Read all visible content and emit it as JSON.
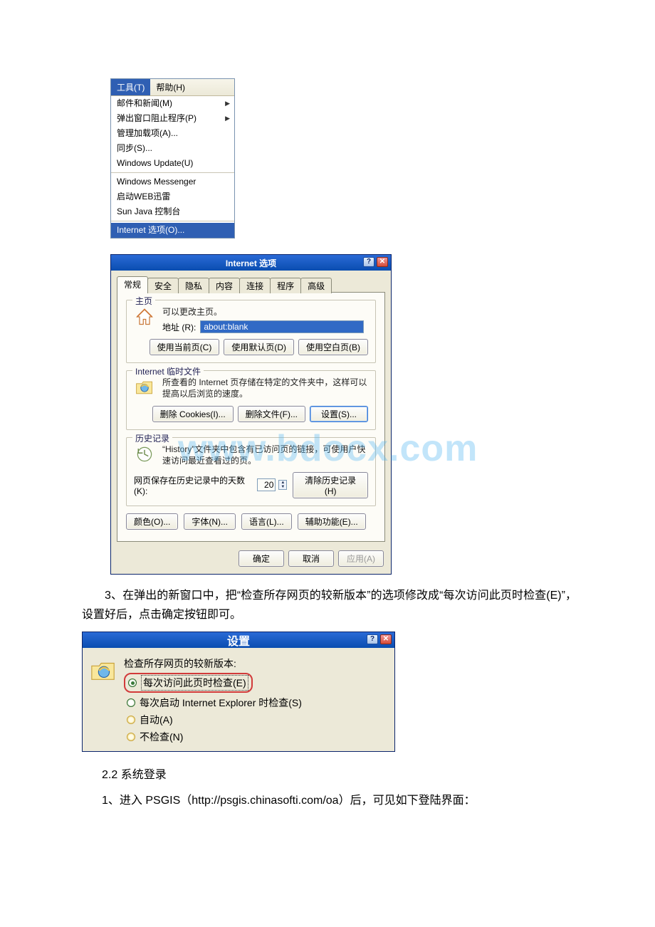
{
  "menubar": {
    "tools_label": "工具(T)",
    "help_label": "帮助(H)",
    "items1": [
      "邮件和新闻(M)",
      "弹出窗口阻止程序(P)",
      "管理加载项(A)...",
      "同步(S)...",
      "Windows Update(U)"
    ],
    "items2": [
      "Windows Messenger",
      "启动WEB迅雷",
      "Sun Java 控制台"
    ],
    "selected": "Internet 选项(O)..."
  },
  "options": {
    "title": "Internet 选项",
    "tabs": [
      "常规",
      "安全",
      "隐私",
      "内容",
      "连接",
      "程序",
      "高级"
    ],
    "home": {
      "legend": "主页",
      "note": "可以更改主页。",
      "addr_label": "地址 (R):",
      "addr_value": "about:blank",
      "btn_current": "使用当前页(C)",
      "btn_default": "使用默认页(D)",
      "btn_blank": "使用空白页(B)"
    },
    "temp": {
      "legend": "Internet 临时文件",
      "note": "所查看的 Internet 页存储在特定的文件夹中，这样可以提高以后浏览的速度。",
      "btn_cookies": "删除 Cookies(I)...",
      "btn_files": "删除文件(F)...",
      "btn_settings": "设置(S)..."
    },
    "history": {
      "legend": "历史记录",
      "note": "“History”文件夹中包含有已访问页的链接，可使用户快速访问最近查看过的页。",
      "days_label": "网页保存在历史记录中的天数 (K):",
      "days_value": "20",
      "btn_clear": "清除历史记录(H)"
    },
    "bottom": {
      "colors": "颜色(O)...",
      "fonts": "字体(N)...",
      "langs": "语言(L)...",
      "access": "辅助功能(E)..."
    },
    "actions": {
      "ok": "确定",
      "cancel": "取消",
      "apply": "应用(A)"
    }
  },
  "para3": "3、在弹出的新窗口中，把“检查所存网页的较新版本”的选项修改成“每次访问此页时检查(E)”，设置好后，点击确定按钮即可。",
  "settings": {
    "title": "设置",
    "heading": "检查所存网页的较新版本:",
    "opt_e": "每次访问此页时检查(E)",
    "opt_s": "每次启动 Internet Explorer 时检查(S)",
    "opt_a": "自动(A)",
    "opt_n": "不检查(N)"
  },
  "section22": "2.2 系统登录",
  "para_psgis": "1、进入 PSGIS（http://psgis.chinasofti.com/oa）后，可见如下登陆界面：",
  "watermark": "www.bdocx.com"
}
